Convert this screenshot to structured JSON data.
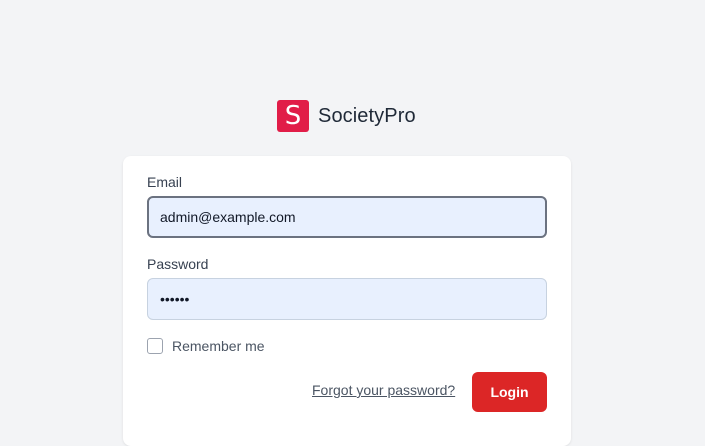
{
  "app": {
    "logo_letter": "S",
    "name": "SocietyPro",
    "brand_color": "#e11d48"
  },
  "login_form": {
    "email_label": "Email",
    "email_value": "admin@example.com",
    "password_label": "Password",
    "password_value": "••••••",
    "remember_label": "Remember me",
    "remember_checked": false,
    "forgot_link": "Forgot your password?",
    "login_button": "Login",
    "button_color": "#dc2626"
  }
}
